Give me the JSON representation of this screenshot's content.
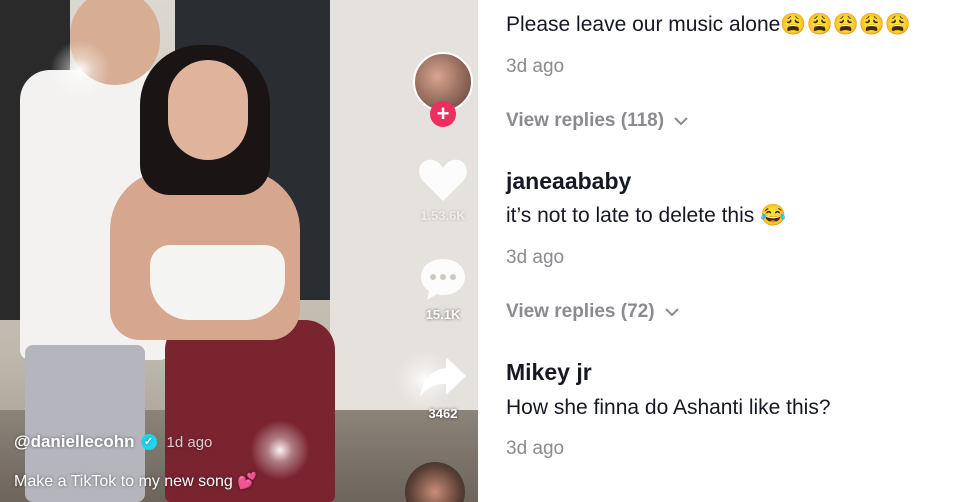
{
  "video": {
    "username": "@daniellecohn",
    "posted": "1d ago",
    "caption": "Make a TikTok to my new song 💕",
    "likes": "1.53.6K",
    "comments_count": "15.1K",
    "shares_count": "3462",
    "icons": [
      "avatar",
      "plus-icon",
      "heart-icon",
      "comment-icon",
      "share-icon",
      "verified-icon",
      "music-disc"
    ]
  },
  "comments": [
    {
      "user": "",
      "text": "Please leave our music alone😩😩😩😩😩",
      "time": "3d ago",
      "replies": "View replies (118)"
    },
    {
      "user": "janeaababy",
      "text": "it’s not to late to delete this 😂",
      "time": "3d ago",
      "replies": "View replies (72)"
    },
    {
      "user": "Mikey jr",
      "text": "How she finna do Ashanti like this?",
      "time": "3d ago"
    }
  ],
  "colors": {
    "follow": "#ee2e5f",
    "verified": "#20d5ec",
    "muted": "#8a8b91",
    "text": "#161823"
  }
}
